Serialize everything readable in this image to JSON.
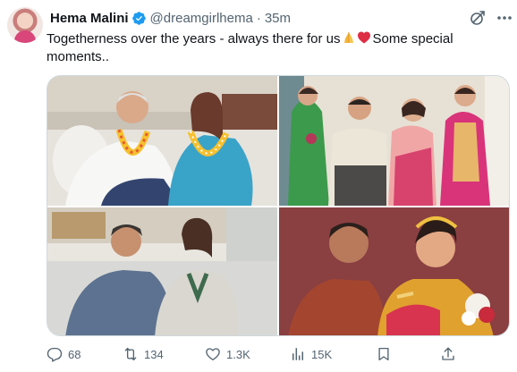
{
  "author": {
    "name": "Hema Malini",
    "handle": "@dreamgirlhema",
    "separator": "·",
    "time": "35m"
  },
  "tweet": {
    "text_before": "Togetherness over the years - always there for us",
    "text_after": "Some special moments..",
    "emoji": [
      "folded-hands-emoji",
      "red-heart-emoji"
    ]
  },
  "media": {
    "count": 4,
    "photos": [
      "photo-1",
      "photo-2",
      "photo-3",
      "photo-4"
    ]
  },
  "actions": {
    "replies": "68",
    "reposts": "134",
    "likes": "1.3K",
    "views": "15K"
  },
  "icons": {
    "verified": "verified-badge-icon",
    "grok": "grok-icon",
    "more": "more-icon",
    "reply": "reply-icon",
    "repost": "repost-icon",
    "like": "like-icon",
    "views": "views-icon",
    "bookmark": "bookmark-icon",
    "share": "share-icon"
  },
  "colors": {
    "text": "#0f1419",
    "secondary": "#536471",
    "verified": "#1d9bf0",
    "border": "#cfd9de"
  }
}
